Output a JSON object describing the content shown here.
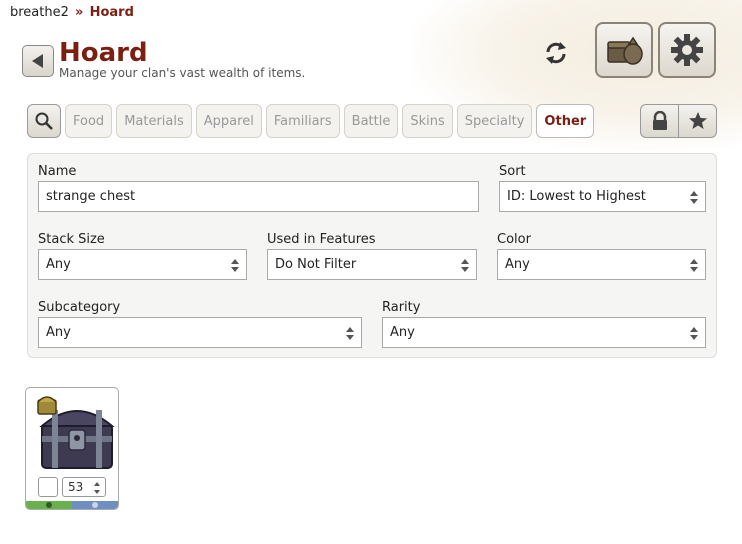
{
  "breadcrumb": {
    "user": "breathe2",
    "separator": "»",
    "current": "Hoard"
  },
  "header": {
    "title": "Hoard",
    "subtitle": "Manage your clan's vast wealth of items."
  },
  "icons": {
    "back": "back-arrow-icon",
    "refresh": "refresh-icon",
    "treasure": "treasure-sack-icon",
    "settings": "gear-icon",
    "search": "search-icon",
    "lock": "lock-icon",
    "star": "star-icon"
  },
  "tabs": [
    "Food",
    "Materials",
    "Apparel",
    "Familiars",
    "Battle",
    "Skins",
    "Specialty",
    "Other"
  ],
  "active_tab": "Other",
  "filters": {
    "name_label": "Name",
    "name_value": "strange chest",
    "sort_label": "Sort",
    "sort_value": "ID: Lowest to Highest",
    "stack_label": "Stack Size",
    "stack_value": "Any",
    "features_label": "Used in Features",
    "features_value": "Do Not Filter",
    "color_label": "Color",
    "color_value": "Any",
    "subcategory_label": "Subcategory",
    "subcategory_value": "Any",
    "rarity_label": "Rarity",
    "rarity_value": "Any"
  },
  "items": [
    {
      "icon": "strange-chest-icon",
      "quantity": "53",
      "checked": false
    }
  ],
  "colors": {
    "accent": "#7a1f12",
    "bar_green": "#6ab04c",
    "bar_blue": "#6f8fc2"
  }
}
